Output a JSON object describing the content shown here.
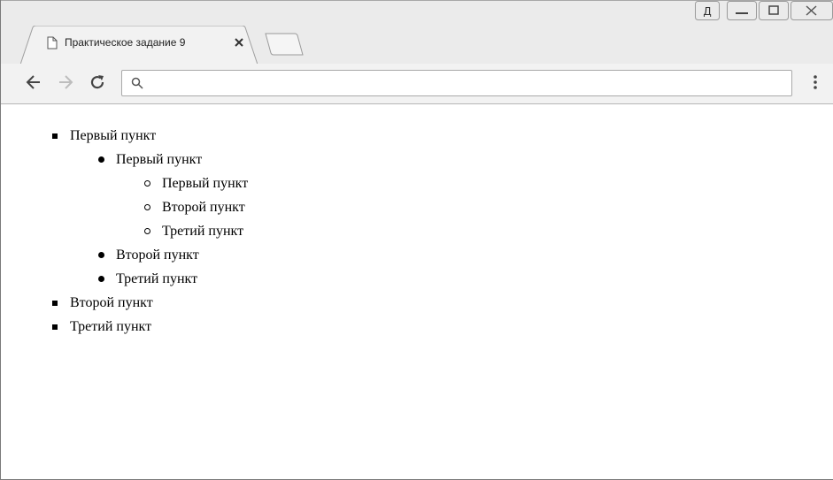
{
  "tab": {
    "title": "Практическое задание 9"
  },
  "omnibox": {
    "value": "",
    "placeholder": ""
  },
  "icons": {
    "tab_doc": "document-icon",
    "tab_close": "close-icon",
    "new_tab": "new-tab-icon",
    "back": "back-arrow-icon",
    "forward": "forward-arrow-icon",
    "reload": "reload-icon",
    "search": "search-icon",
    "menu": "more-vert-icon",
    "user": "user-icon",
    "minimize": "minimize-icon",
    "maximize": "maximize-icon",
    "close_window": "close-window-icon"
  },
  "list": {
    "items": [
      {
        "label": "Первый пункт",
        "children": [
          {
            "label": "Первый пункт",
            "children": [
              {
                "label": "Первый пункт"
              },
              {
                "label": "Второй пункт"
              },
              {
                "label": "Третий пункт"
              }
            ]
          },
          {
            "label": "Второй пункт"
          },
          {
            "label": "Третий пункт"
          }
        ]
      },
      {
        "label": "Второй пункт"
      },
      {
        "label": "Третий пункт"
      }
    ]
  }
}
